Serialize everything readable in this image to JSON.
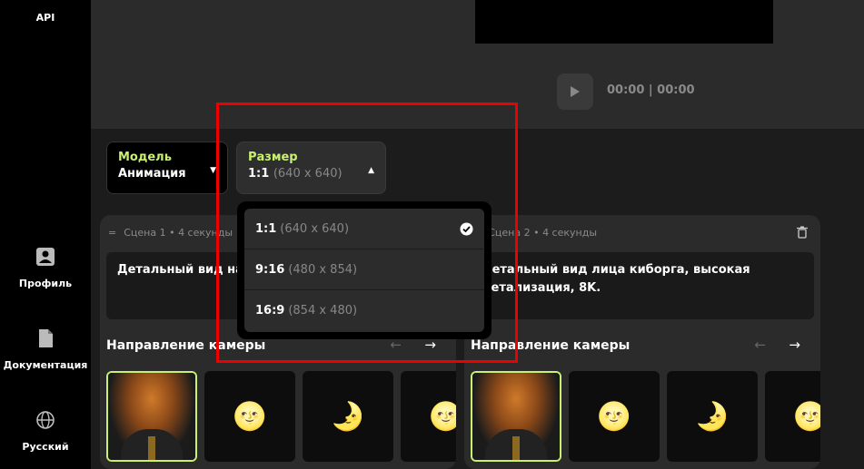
{
  "sidebar": {
    "api": "API",
    "items": [
      {
        "label": "Профиль",
        "icon": "profile-icon"
      },
      {
        "label": "Документация",
        "icon": "document-icon"
      },
      {
        "label": "Русский",
        "icon": "globe-icon"
      }
    ]
  },
  "player": {
    "time": "00:00 | 00:00"
  },
  "model": {
    "label": "Модель",
    "value": "Анимация"
  },
  "size": {
    "label": "Размер",
    "value": "1:1",
    "dims": "(640 x 640)"
  },
  "dropdown": {
    "options": [
      {
        "ratio": "1:1",
        "dims": "(640 x 640)",
        "selected": true
      },
      {
        "ratio": "9:16",
        "dims": "(480 x 854)",
        "selected": false
      },
      {
        "ratio": "16:9",
        "dims": "(854 x 480)",
        "selected": false
      }
    ]
  },
  "scenes": [
    {
      "header": "Сцена 1 • 4 секунды",
      "prompt": "Детальный вид на детализация.",
      "camera_title": "Направление камеры",
      "prev": "←",
      "next": "→"
    },
    {
      "header": "Сцена 2 • 4 секунды",
      "prompt": "Детальный вид лица киборга, высокая детализация, 8K.",
      "camera_title": "Направление камеры",
      "prev": "←",
      "next": "→"
    }
  ],
  "thumb_glyphs": {
    "full_moon": "🌝",
    "crescent": "🌛"
  },
  "colors": {
    "accent": "#c9f070",
    "highlight": "#e00000"
  }
}
